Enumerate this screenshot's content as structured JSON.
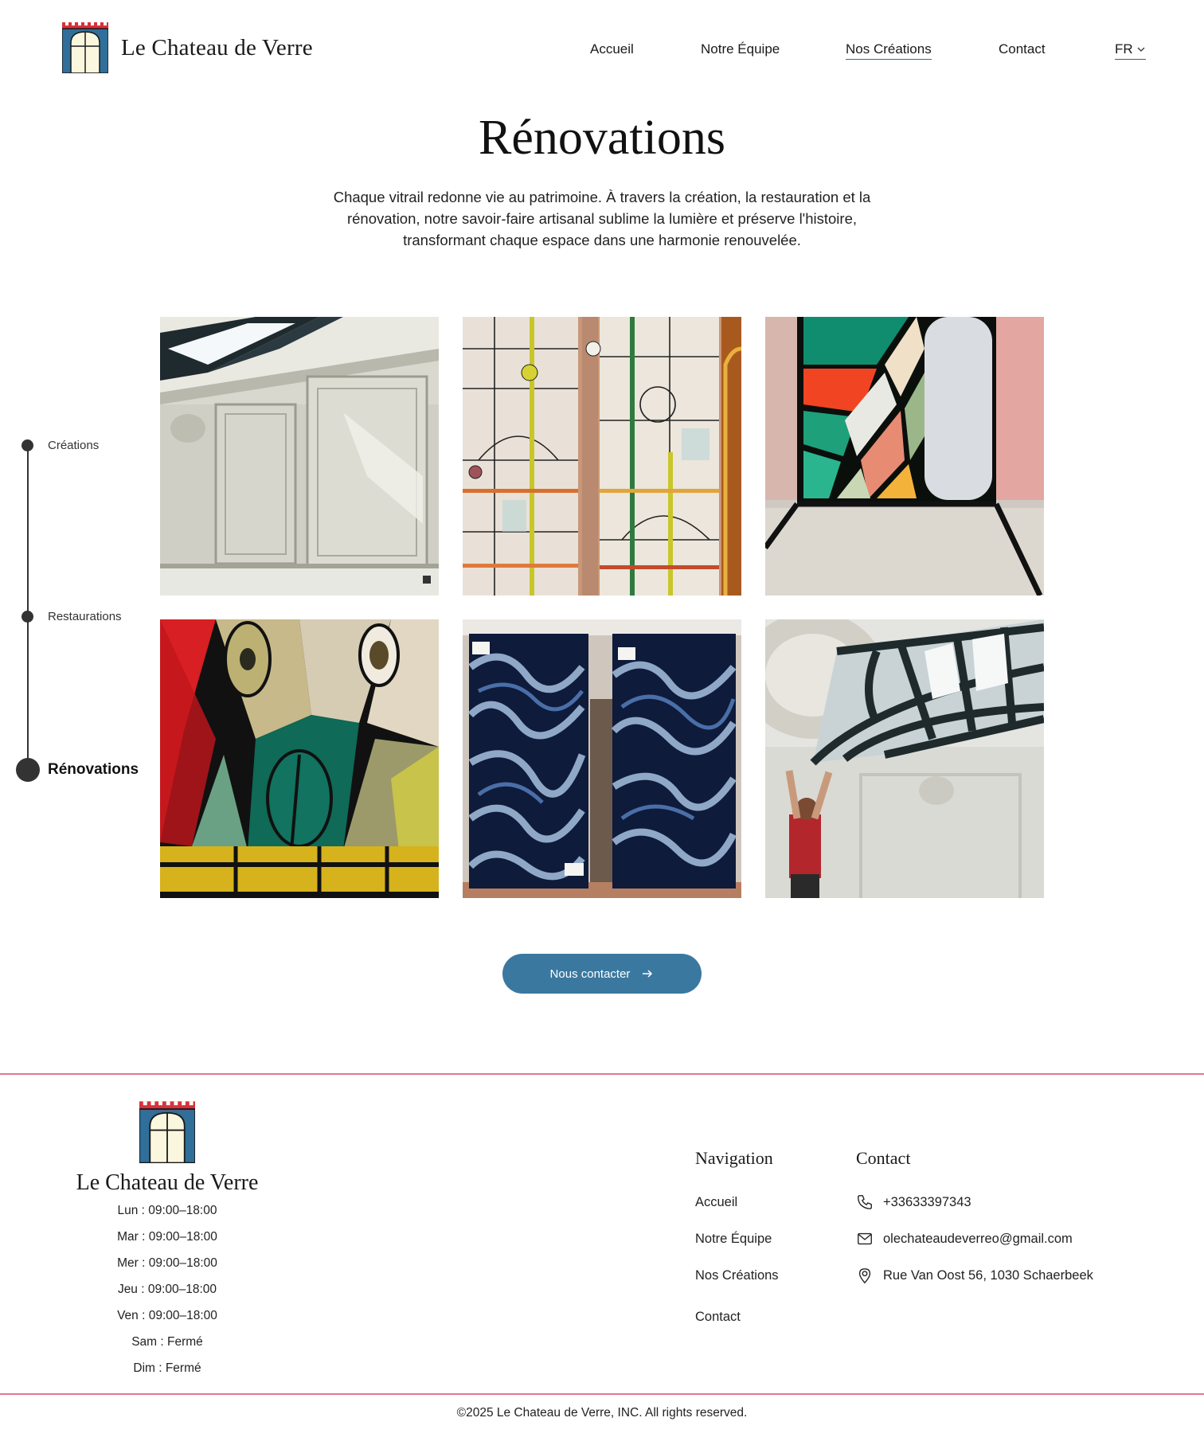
{
  "colors": {
    "accent": "#3a78a0",
    "divider": "#e07a8c",
    "logo_red": "#d9303c",
    "logo_blue": "#2f6f99",
    "logo_cream": "#fbf7df"
  },
  "header": {
    "brand": "Le Chateau de Verre",
    "nav": [
      {
        "label": "Accueil",
        "active": false
      },
      {
        "label": "Notre Équipe",
        "active": false
      },
      {
        "label": "Nos Créations",
        "active": true
      },
      {
        "label": "Contact",
        "active": false
      }
    ],
    "language": "FR",
    "language_icon": "chevron-down-icon"
  },
  "hero": {
    "title": "Rénovations",
    "intro_lines": [
      "Chaque vitrail redonne vie au patrimoine. À travers la création, la restauration et la",
      "rénovation, notre savoir-faire artisanal sublime la lumière et préserve l'histoire,",
      "transformant chaque espace dans une harmonie renouvelée."
    ]
  },
  "timeline": {
    "items": [
      {
        "label": "Créations",
        "active": false
      },
      {
        "label": "Restaurations",
        "active": false
      },
      {
        "label": "Rénovations",
        "active": true
      }
    ]
  },
  "gallery": {
    "images": [
      "paneled-wall-skylight-photo",
      "geometric-leaded-glass-doors-photo",
      "colorful-stained-glass-panel-photo",
      "red-green-ornate-stained-glass-photo",
      "blue-swirl-glass-sheets-photo",
      "skylight-installation-photo"
    ]
  },
  "cta": {
    "label": "Nous contacter",
    "icon": "arrow-right-icon"
  },
  "footer": {
    "brand": "Le Chateau de Verre",
    "hours": [
      "Lun : 09:00–18:00",
      "Mar : 09:00–18:00",
      "Mer : 09:00–18:00",
      "Jeu : 09:00–18:00",
      "Ven : 09:00–18:00",
      "Sam : Fermé",
      "Dim : Fermé"
    ],
    "navigation_title": "Navigation",
    "navigation_links": [
      "Accueil",
      "Notre Équipe",
      "Nos Créations",
      "Contact"
    ],
    "contact_title": "Contact",
    "phone": "+33633397343",
    "email": "olechateaudeverreo@gmail.com",
    "address": "Rue Van Oost 56, 1030 Schaerbeek",
    "copyright": "©2025 Le Chateau de Verre, INC. All rights reserved."
  }
}
